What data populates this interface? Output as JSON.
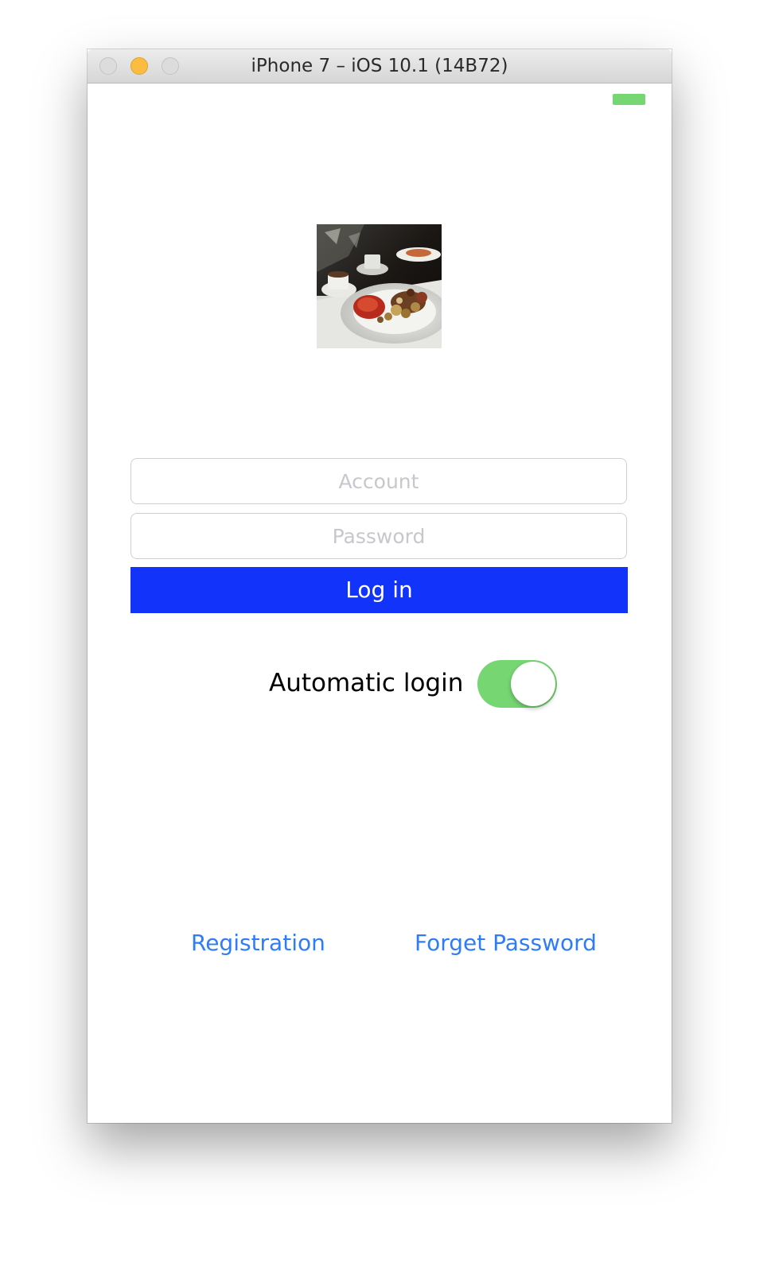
{
  "window": {
    "title": "iPhone 7 – iOS 10.1 (14B72)"
  },
  "status_bar": {
    "battery_icon": "battery-icon",
    "battery_color": "#76d672"
  },
  "logo": {
    "icon": "food-photo-icon"
  },
  "login_form": {
    "account_placeholder": "Account",
    "account_value": "",
    "password_placeholder": "Password",
    "password_value": "",
    "login_label": "Log in",
    "login_color": "#1233fa"
  },
  "auto_login": {
    "label": "Automatic login",
    "enabled": true,
    "toggle_color": "#76d672"
  },
  "links": {
    "registration": "Registration",
    "forget_password": "Forget Password",
    "color": "#2f7df6"
  }
}
